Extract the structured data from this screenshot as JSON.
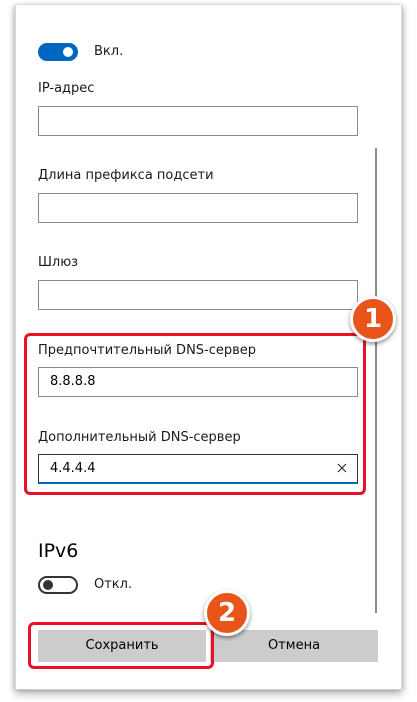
{
  "ipv4": {
    "toggle_label": "Вкл.",
    "toggle_state": "on",
    "ip_address": {
      "label": "IP-адрес",
      "value": ""
    },
    "subnet_prefix": {
      "label": "Длина префикса подсети",
      "value": ""
    },
    "gateway": {
      "label": "Шлюз",
      "value": ""
    },
    "preferred_dns": {
      "label": "Предпочтительный DNS-сервер",
      "value": "8.8.8.8"
    },
    "alternate_dns": {
      "label": "Дополнительный DNS-сервер",
      "value": "4.4.4.4"
    }
  },
  "ipv6": {
    "title": "IPv6",
    "toggle_label": "Откл.",
    "toggle_state": "off"
  },
  "buttons": {
    "save_label": "Сохранить",
    "cancel_label": "Отмена"
  },
  "annotations": {
    "badge_1": "1",
    "badge_2": "2"
  },
  "colors": {
    "accent": "#0067c0",
    "highlight": "#e8102a",
    "badge": "#e8541a",
    "button_bg": "#cccccc"
  },
  "icons": {
    "clear": "close-icon"
  }
}
